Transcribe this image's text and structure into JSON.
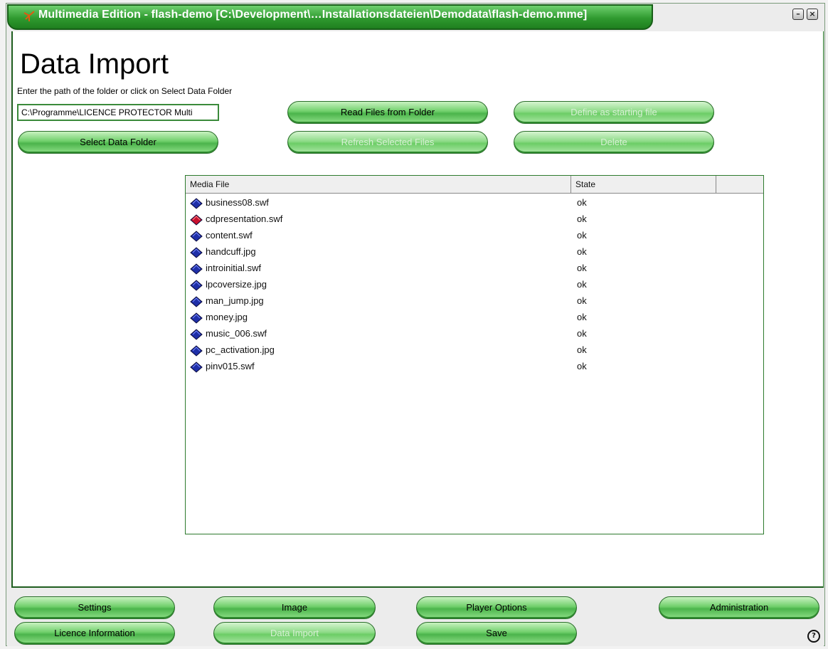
{
  "window": {
    "title": "Multimedia Edition - flash-demo [C:\\Development\\…Installationsdateien\\Demodata\\flash-demo.mme]"
  },
  "page": {
    "title": "Data Import",
    "hint": "Enter the path of the folder or click on Select Data Folder",
    "path_value": "C:\\Programme\\LICENCE PROTECTOR Multi"
  },
  "buttons": {
    "select_folder": "Select Data Folder",
    "read_files": "Read Files from Folder",
    "refresh_selected": "Refresh Selected Files",
    "define_start": "Define as starting file",
    "delete": "Delete"
  },
  "table": {
    "col_file": "Media File",
    "col_state": "State",
    "rows": [
      {
        "file": "business08.swf",
        "state": "ok",
        "icon": "blue-gem-icon"
      },
      {
        "file": "cdpresentation.swf",
        "state": "ok",
        "icon": "red-gem-icon"
      },
      {
        "file": "content.swf",
        "state": "ok",
        "icon": "blue-gem-icon"
      },
      {
        "file": "handcuff.jpg",
        "state": "ok",
        "icon": "blue-gem-icon"
      },
      {
        "file": "introinitial.swf",
        "state": "ok",
        "icon": "blue-gem-icon"
      },
      {
        "file": "lpcoversize.jpg",
        "state": "ok",
        "icon": "blue-gem-icon"
      },
      {
        "file": "man_jump.jpg",
        "state": "ok",
        "icon": "blue-gem-icon"
      },
      {
        "file": "money.jpg",
        "state": "ok",
        "icon": "blue-gem-icon"
      },
      {
        "file": "music_006.swf",
        "state": "ok",
        "icon": "blue-gem-icon"
      },
      {
        "file": "pc_activation.jpg",
        "state": "ok",
        "icon": "blue-gem-icon"
      },
      {
        "file": "pinv015.swf",
        "state": "ok",
        "icon": "blue-gem-icon"
      }
    ]
  },
  "nav": {
    "settings": "Settings",
    "image": "Image",
    "player_options": "Player Options",
    "administration": "Administration",
    "licence_information": "Licence Information",
    "data_import": "Data Import",
    "save": "Save"
  },
  "help_symbol": "?",
  "colors": {
    "accent": "#4bb44b",
    "border": "#2d7a2d"
  }
}
